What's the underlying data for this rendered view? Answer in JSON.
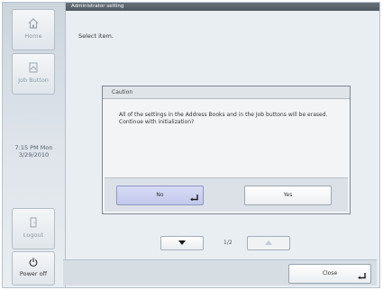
{
  "sidebar": {
    "home_label": "Home",
    "job_button_label": "Job Button",
    "clock": {
      "time": "7:15 PM  Mon",
      "date": "3/29/2010"
    },
    "logout_label": "Logout",
    "power_off_label": "Power off"
  },
  "header": {
    "title": "Administrator setting"
  },
  "main": {
    "instruction": "Select item."
  },
  "dialog": {
    "title": "Caution",
    "message": "All of the settings in the Address Books and in the Job buttons will be erased.  Continue with initialization?",
    "no_label": "No",
    "yes_label": "Yes"
  },
  "pager": {
    "indicator": "1/2"
  },
  "footer": {
    "close_label": "Close"
  },
  "colors": {
    "header_bg": "#58606a",
    "selected_button": "#c8cdef",
    "accent": "#1a1a1a"
  }
}
